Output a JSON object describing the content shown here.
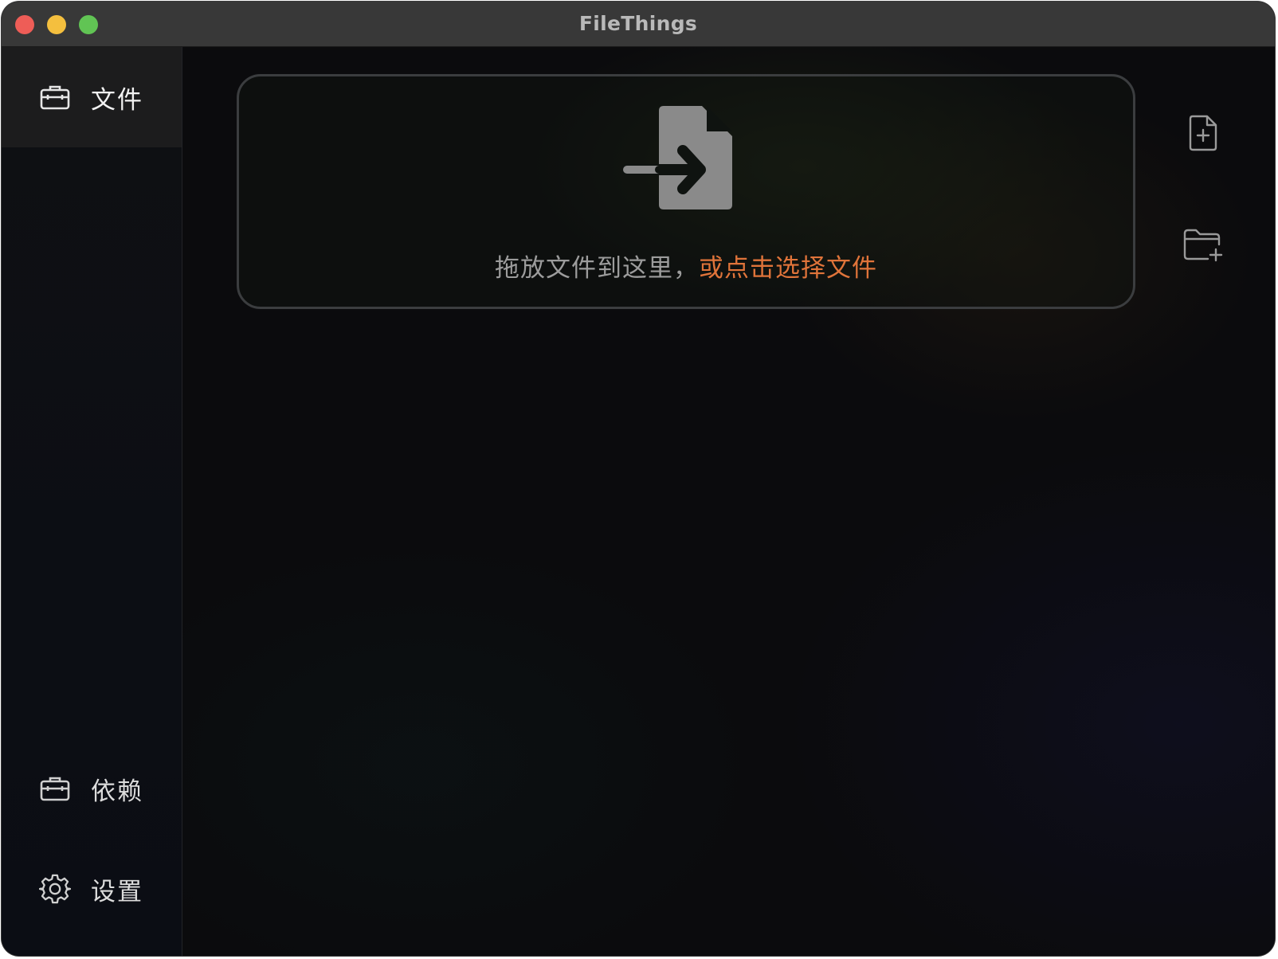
{
  "window": {
    "title": "FileThings"
  },
  "sidebar": {
    "items": [
      {
        "label": "文件",
        "icon": "briefcase-icon",
        "active": true
      },
      {
        "label": "依赖",
        "icon": "briefcase-icon",
        "active": false
      },
      {
        "label": "设置",
        "icon": "gear-icon",
        "active": false
      }
    ]
  },
  "dropzone": {
    "text_plain": "拖放文件到这里，",
    "text_link": "或点击选择文件",
    "icon": "file-import-icon"
  },
  "actions": {
    "add_file_icon": "file-plus-icon",
    "add_folder_icon": "folder-plus-icon"
  },
  "colors": {
    "accent": "#e0743a",
    "background": "#0b0b0d",
    "sidebar_active": "#1c1c1d",
    "traffic_close": "#ee5d57",
    "traffic_minimize": "#f4bf3e",
    "traffic_zoom": "#61c454"
  }
}
